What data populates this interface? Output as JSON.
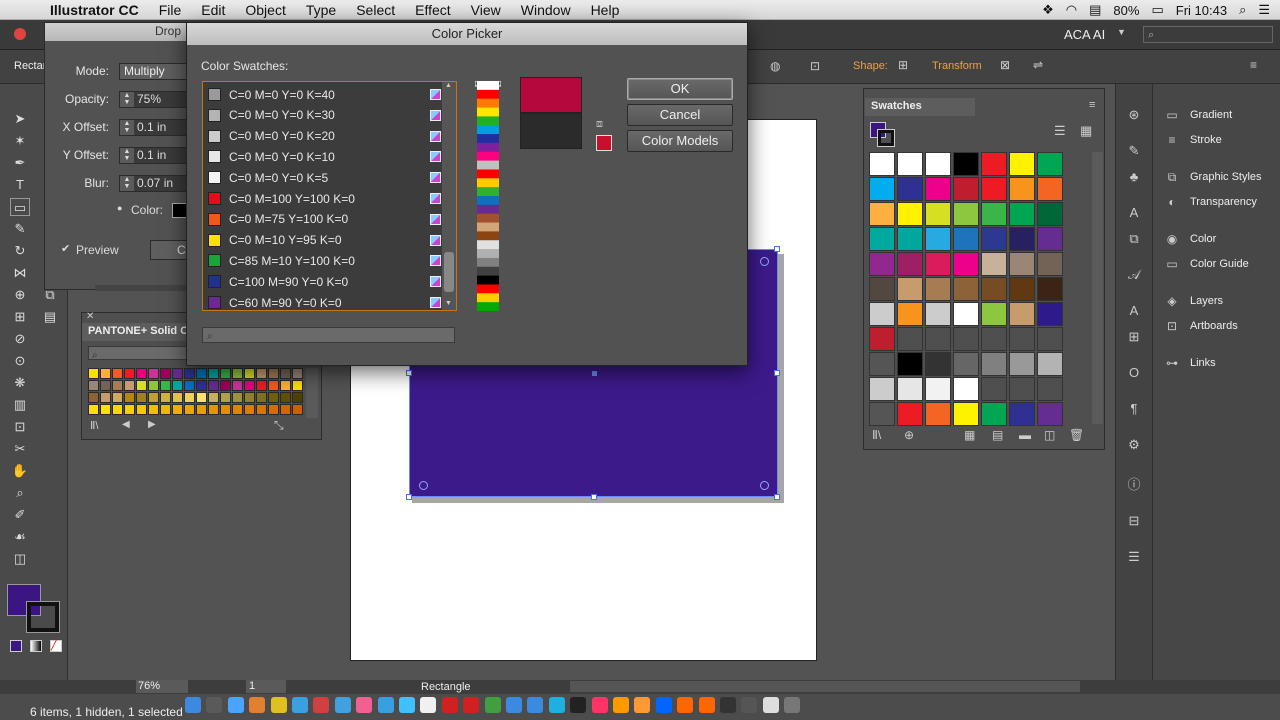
{
  "menubar": {
    "app": "Illustrator CC",
    "items": [
      "File",
      "Edit",
      "Object",
      "Type",
      "Select",
      "Effect",
      "View",
      "Window",
      "Help"
    ],
    "battery": "80%",
    "clock": "Fri 10:43"
  },
  "appbar": {
    "workspace": "ACA AI"
  },
  "control": {
    "object_label": "Rectan",
    "shape_label": "Shape:",
    "transform_label": "Transform"
  },
  "drop_shadow": {
    "title": "Drop",
    "mode_label": "Mode:",
    "mode_value": "Multiply",
    "opacity_label": "Opacity:",
    "opacity_value": "75%",
    "xoffset_label": "X Offset:",
    "xoffset_value": "0.1 in",
    "yoffset_label": "Y Offset:",
    "yoffset_value": "0.1 in",
    "blur_label": "Blur:",
    "blur_value": "0.07 in",
    "color_label": "Color:",
    "preview_label": "Preview",
    "cancel_partial": "Ca"
  },
  "pantone": {
    "title": "PANTONE+ Solid C"
  },
  "color_picker": {
    "title": "Color Picker",
    "swatches_label": "Color Swatches:",
    "swatches": [
      {
        "name": "C=0 M=0 Y=0 K=40",
        "color": "#9a9a9a"
      },
      {
        "name": "C=0 M=0 Y=0 K=30",
        "color": "#b3b3b3"
      },
      {
        "name": "C=0 M=0 Y=0 K=20",
        "color": "#cccccc"
      },
      {
        "name": "C=0 M=0 Y=0 K=10",
        "color": "#e6e6e6"
      },
      {
        "name": "C=0 M=0 Y=0 K=5",
        "color": "#f2f2f2"
      },
      {
        "name": "C=0 M=100 Y=100 K=0",
        "color": "#e10f1a"
      },
      {
        "name": "C=0 M=75 Y=100 K=0",
        "color": "#f05a18"
      },
      {
        "name": "C=0 M=10 Y=95 K=0",
        "color": "#ffe100"
      },
      {
        "name": "C=85 M=10 Y=100 K=0",
        "color": "#17a53c"
      },
      {
        "name": "C=100 M=90 Y=0 K=0",
        "color": "#22308e"
      },
      {
        "name": "C=60 M=90 Y=0 K=0",
        "color": "#6b2a90"
      }
    ],
    "ok": "OK",
    "cancel": "Cancel",
    "color_models": "Color Models",
    "new_color": "#b5083d",
    "old_color": "#2b2b2b"
  },
  "swatches_panel": {
    "title": "Swatches"
  },
  "right_panels": [
    "Gradient",
    "Stroke",
    "Graphic Styles",
    "Transparency",
    "Color",
    "Color Guide",
    "Layers",
    "Artboards",
    "Links"
  ],
  "status": {
    "zoom": "76%",
    "artboard": "1",
    "tool": "Rectangle",
    "selection": "6 items, 1 hidden, 1 selected"
  }
}
